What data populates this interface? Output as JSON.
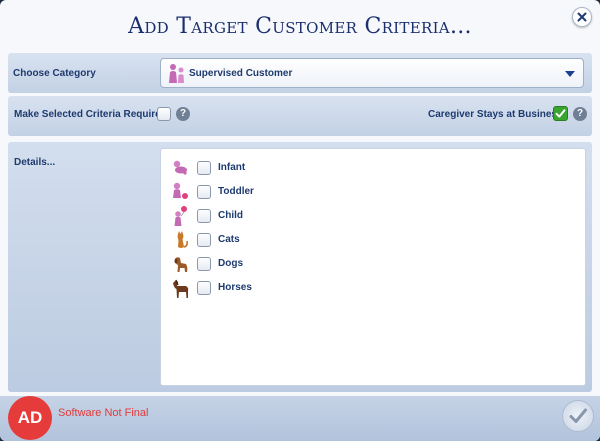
{
  "dialog": {
    "title": "Add Target Customer Criteria...",
    "close_icon": "close-icon"
  },
  "category": {
    "label": "Choose Category",
    "selected": "Supervised Customer",
    "icon": "supervised-customer-icon"
  },
  "required": {
    "label": "Make Selected Criteria Required",
    "checked": false,
    "caregiver_label": "Caregiver Stays at Business",
    "caregiver_checked": true,
    "help_glyph": "?"
  },
  "details": {
    "label": "Details...",
    "options": [
      {
        "label": "Infant",
        "icon": "infant-icon",
        "checked": false
      },
      {
        "label": "Toddler",
        "icon": "toddler-icon",
        "checked": false
      },
      {
        "label": "Child",
        "icon": "child-icon",
        "checked": false
      },
      {
        "label": "Cats",
        "icon": "cat-icon",
        "checked": false
      },
      {
        "label": "Dogs",
        "icon": "dog-icon",
        "checked": false
      },
      {
        "label": "Horses",
        "icon": "horse-icon",
        "checked": false
      }
    ]
  },
  "footer": {
    "badge": "AD",
    "notice": "Software Not Final",
    "confirm_icon": "checkmark-icon"
  },
  "colors": {
    "title": "#1b2f6e",
    "label": "#1e3a6e",
    "band": "#c3d1e5",
    "check_green": "#39a52f",
    "notice_red": "#e23a3a"
  }
}
